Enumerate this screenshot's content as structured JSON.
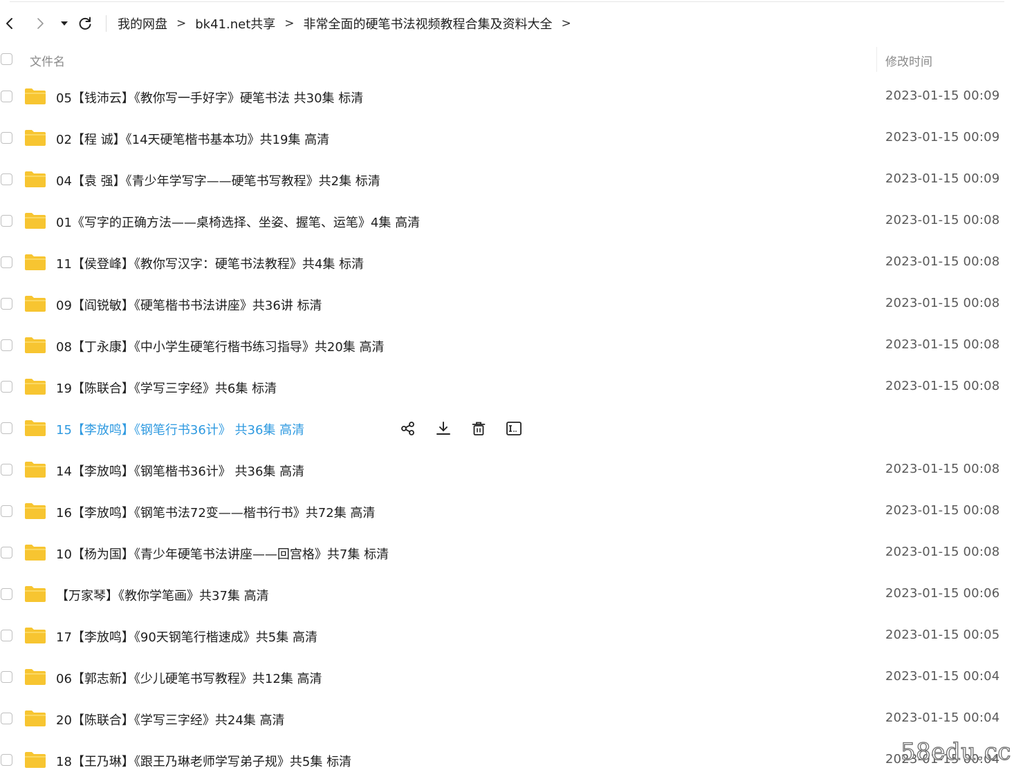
{
  "toolbar": {
    "back_icon": "chevron-left-icon",
    "forward_icon": "chevron-right-icon",
    "history_icon": "caret-down-icon",
    "refresh_icon": "refresh-icon",
    "breadcrumb": [
      "我的网盘",
      "bk41.net共享",
      "非常全面的硬笔书法视频教程合集及资料大全"
    ],
    "separator": ">"
  },
  "list_header": {
    "name_label": "文件名",
    "time_label": "修改时间"
  },
  "files": [
    {
      "name": "05【钱沛云】《教你写一手好字》硬笔书法  共30集 标清",
      "modified": "2023-01-15 00:09"
    },
    {
      "name": "02【程  诚】《14天硬笔楷书基本功》共19集 高清",
      "modified": "2023-01-15 00:09"
    },
    {
      "name": "04【袁  强】《青少年学写字——硬笔书写教程》共2集 标清",
      "modified": "2023-01-15 00:09"
    },
    {
      "name": "01《写字的正确方法——桌椅选择、坐姿、握笔、运笔》4集 高清",
      "modified": "2023-01-15 00:08"
    },
    {
      "name": "11【侯登峰】《教你写汉字：硬笔书法教程》共4集 标清",
      "modified": "2023-01-15 00:08"
    },
    {
      "name": "09【阎锐敏】《硬笔楷书书法讲座》共36讲 标清",
      "modified": "2023-01-15 00:08"
    },
    {
      "name": "08【丁永康】《中小学生硬笔行楷书练习指导》共20集 高清",
      "modified": "2023-01-15 00:08"
    },
    {
      "name": "19【陈联合】《学写三字经》共6集 标清",
      "modified": "2023-01-15 00:08"
    },
    {
      "name": "15【李放鸣】《钢笔行书36计》 共36集 高清",
      "modified": "",
      "hovered": true
    },
    {
      "name": "14【李放鸣】《钢笔楷书36计》 共36集 高清",
      "modified": "2023-01-15 00:08"
    },
    {
      "name": "16【李放鸣】《钢笔书法72变——楷书行书》共72集 高清",
      "modified": "2023-01-15 00:08"
    },
    {
      "name": "10【杨为国】《青少年硬笔书法讲座——回宫格》共7集 标清",
      "modified": "2023-01-15 00:08"
    },
    {
      "name": "【万家琴】《教你学笔画》共37集 高清",
      "modified": "2023-01-15 00:06"
    },
    {
      "name": "17【李放鸣】《90天钢笔行楷速成》共5集 高清",
      "modified": "2023-01-15 00:05"
    },
    {
      "name": "06【郭志新】《少儿硬笔书写教程》共12集 高清",
      "modified": "2023-01-15 00:04"
    },
    {
      "name": "20【陈联合】《学写三字经》共24集 高清",
      "modified": "2023-01-15 00:04"
    },
    {
      "name": "18【王乃琳】《跟王乃琳老师学写弟子规》共5集 标清",
      "modified": "2023-01-15 00:04"
    }
  ],
  "hover_actions": [
    "share-icon",
    "download-icon",
    "delete-icon",
    "rename-icon"
  ],
  "icon": "folder-icon",
  "colors": {
    "folder": "#f7c531",
    "hover_text": "#2f9ae0",
    "muted_text": "#8a8a8a"
  },
  "watermark": "58edu.cc"
}
